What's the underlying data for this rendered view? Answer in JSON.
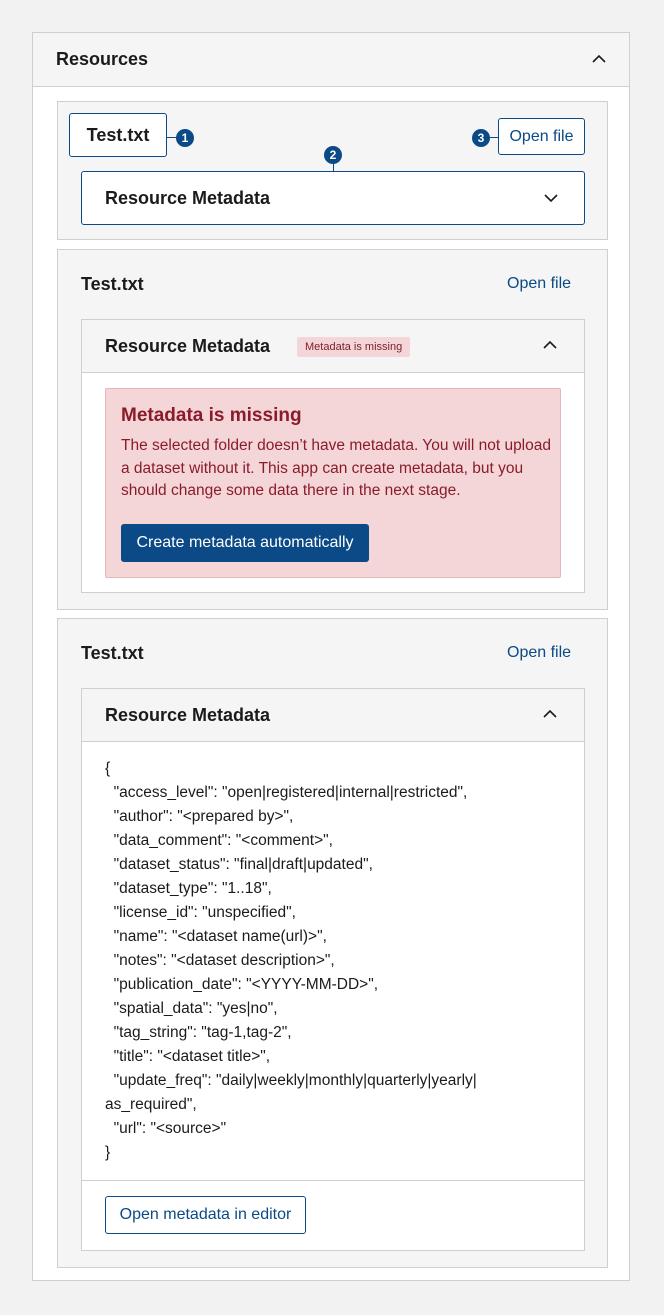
{
  "panel": {
    "title": "Resources"
  },
  "card1": {
    "file_name": "Test.txt",
    "open_label": "Open file",
    "accordion_title": "Resource Metadata",
    "callouts": [
      "1",
      "2",
      "3"
    ]
  },
  "card2": {
    "file_name": "Test.txt",
    "open_label": "Open file",
    "accordion_title": "Resource Metadata",
    "badge": "Metadata is missing",
    "alert": {
      "title": "Metadata is missing",
      "body": "The selected folder doesn’t have metadata. You will not upload a dataset without it. This app can create metadata, but you should change some data there in the next stage.",
      "button": "Create metadata automatically"
    }
  },
  "card3": {
    "file_name": "Test.txt",
    "open_label": "Open file",
    "accordion_title": "Resource Metadata",
    "json_text": "{\n  \"access_level\": \"open|registered|internal|restricted\",\n  \"author\": \"<prepared by>\",\n  \"data_comment\": \"<comment>\",\n  \"dataset_status\": \"final|draft|updated\",\n  \"dataset_type\": \"1..18\",\n  \"license_id\": \"unspecified\",\n  \"name\": \"<dataset name(url)>\",\n  \"notes\": \"<dataset description>\",\n  \"publication_date\": \"<YYYY-MM-DD>\",\n  \"spatial_data\": \"yes|no\",\n  \"tag_string\": \"tag-1,tag-2\",\n  \"title\": \"<dataset title>\",\n  \"update_freq\": \"daily|weekly|monthly|quarterly|yearly|\nas_required\",\n  \"url\": \"<source>\"\n}",
    "editor_button": "Open metadata in editor"
  },
  "colors": {
    "primary": "#0b4a86",
    "error_bg": "#f4d6d9",
    "error_text": "#8a1c2a",
    "border": "#cfcfcf"
  },
  "icons": {
    "collapse": "chevron-up-icon",
    "expand": "chevron-down-icon"
  }
}
